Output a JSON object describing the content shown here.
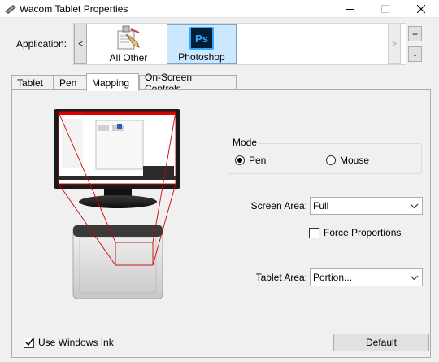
{
  "window": {
    "title": "Wacom Tablet Properties",
    "controls": {
      "minimize": "minimize-icon",
      "maximize": "maximize-icon",
      "close": "close-icon"
    }
  },
  "applications": {
    "label": "Application:",
    "prev_label": "<",
    "next_label": ">",
    "add_label": "+",
    "remove_label": "-",
    "items": [
      {
        "label": "All Other",
        "icon": "all-other-apps-icon",
        "selected": false
      },
      {
        "label": "Photoshop",
        "icon": "photoshop-icon",
        "icon_text": "Ps",
        "selected": true
      }
    ]
  },
  "tabs": [
    {
      "label": "Tablet",
      "active": false
    },
    {
      "label": "Pen",
      "active": false
    },
    {
      "label": "Mapping",
      "active": true
    },
    {
      "label": "On-Screen Controls",
      "active": false
    }
  ],
  "mapping": {
    "mode": {
      "legend": "Mode",
      "options": [
        {
          "label": "Pen",
          "selected": true
        },
        {
          "label": "Mouse",
          "selected": false
        }
      ]
    },
    "screen_area": {
      "label": "Screen Area:",
      "value": "Full"
    },
    "force_proportions": {
      "label": "Force Proportions",
      "checked": false
    },
    "tablet_area": {
      "label": "Tablet Area:",
      "value": "Portion..."
    }
  },
  "footer": {
    "use_windows_ink": {
      "label": "Use Windows Ink",
      "checked": true
    },
    "default_label": "Default"
  },
  "colors": {
    "selected_tile": "#cce8ff",
    "mapping_lines": "#cc0000",
    "photoshop_blue": "#31a8ff",
    "photoshop_bg": "#001e36"
  }
}
